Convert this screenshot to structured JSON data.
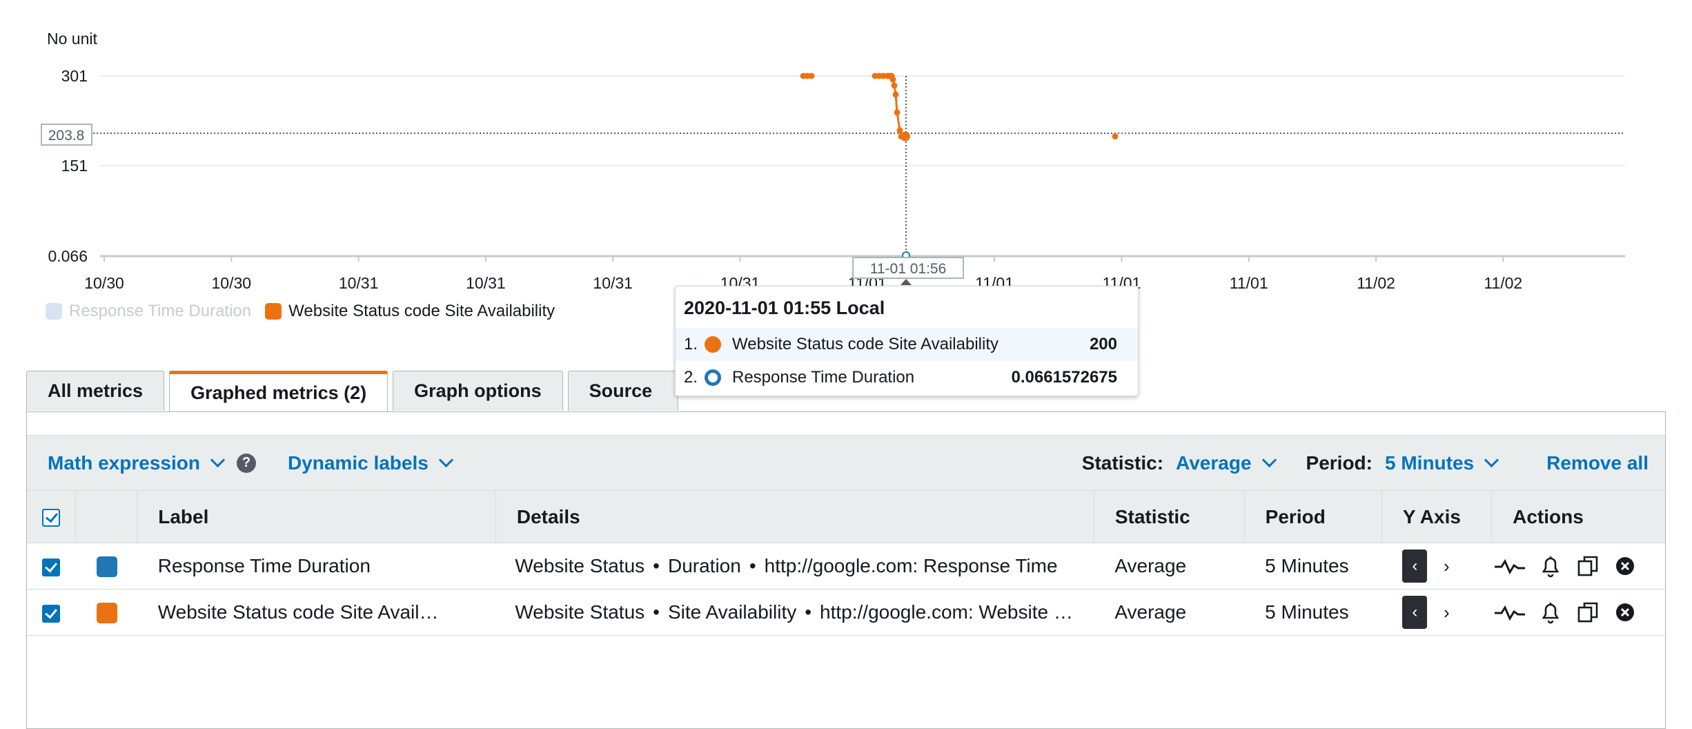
{
  "chart": {
    "unit_label": "No unit",
    "y_ticks": [
      "301",
      "151",
      "0.066"
    ],
    "y_hover_value": "203.8",
    "x_ticks": [
      "10/30",
      "10/30",
      "10/31",
      "10/31",
      "10/31",
      "10/31",
      "11/01",
      "11/01",
      "11/01",
      "11/01",
      "11/02",
      "11/02"
    ],
    "x_hover_time": "11-01 01:56",
    "colors": {
      "availability": "#ec7211",
      "response": "#1f77b4",
      "gridline": "#e9ebed"
    }
  },
  "chart_data": {
    "type": "line",
    "ylabel": "No unit",
    "y_ticks": [
      301,
      151,
      0.066
    ],
    "x_ticks": [
      "10/30",
      "10/30",
      "10/31",
      "10/31",
      "10/31",
      "10/31",
      "11/01",
      "11/01",
      "11/01",
      "11/01",
      "11/02",
      "11/02"
    ],
    "series": [
      {
        "name": "Website Status code Site Availability",
        "color": "#ec7211",
        "values": [
          301,
          301,
          301,
          301,
          301,
          301,
          301,
          301,
          301,
          295,
          285,
          270,
          240,
          210,
          200,
          200,
          200
        ]
      },
      {
        "name": "Response Time Duration",
        "color": "#1f77b4",
        "values": [
          0.066,
          0.066
        ]
      }
    ]
  },
  "legend": [
    {
      "label": "Response Time Duration",
      "color": "#d6e4f0",
      "dimmed": true
    },
    {
      "label": "Website Status code Site Availability",
      "color": "#ec7211",
      "dimmed": false
    }
  ],
  "tooltip": {
    "title": "2020-11-01 01:55 Local",
    "rows": [
      {
        "num": "1.",
        "label": "Website Status code Site Availability",
        "value": "200",
        "color": "#ec7211",
        "style": "filled"
      },
      {
        "num": "2.",
        "label": "Response Time Duration",
        "value": "0.0661572675",
        "color": "#1f77b4",
        "style": "ring"
      }
    ]
  },
  "tabs": [
    "All metrics",
    "Graphed metrics (2)",
    "Graph options",
    "Source"
  ],
  "toolbar": {
    "math_expression": "Math expression",
    "help": "?",
    "dynamic_labels": "Dynamic labels",
    "statistic_label": "Statistic:",
    "statistic_value": "Average",
    "period_label": "Period:",
    "period_value": "5 Minutes",
    "remove_all": "Remove all"
  },
  "table": {
    "headers": {
      "label": "Label",
      "details": "Details",
      "statistic": "Statistic",
      "period": "Period",
      "y_axis": "Y Axis",
      "actions": "Actions"
    },
    "rows": [
      {
        "color": "#1f77b4",
        "label": "Response Time Duration",
        "details": [
          "Website Status",
          "Duration",
          "http://google.com: Response Time"
        ],
        "statistic": "Average",
        "period": "5 Minutes"
      },
      {
        "color": "#ec7211",
        "label": "Website Status code Site Avail…",
        "details": [
          "Website Status",
          "Site Availability",
          "http://google.com: Website …"
        ],
        "statistic": "Average",
        "period": "5 Minutes"
      }
    ],
    "bullet": "•",
    "axis_left": "‹",
    "axis_right": "›"
  }
}
